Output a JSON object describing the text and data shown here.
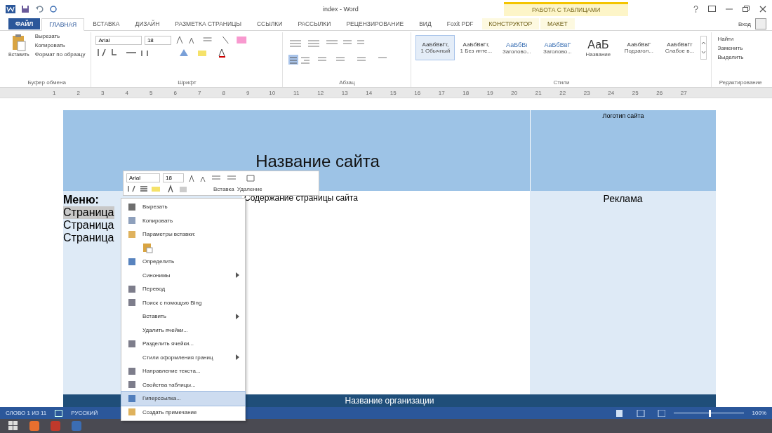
{
  "window": {
    "title": "index - Word",
    "context_tab_group": "РАБОТА С ТАБЛИЦАМИ",
    "sign_in": "Вход"
  },
  "tabs": [
    {
      "label": "ФАЙЛ",
      "kind": "file",
      "selected": false
    },
    {
      "label": "ГЛАВНАЯ",
      "kind": "tab",
      "selected": true
    },
    {
      "label": "ВСТАВКА",
      "kind": "tab",
      "selected": false
    },
    {
      "label": "ДИЗАЙН",
      "kind": "tab",
      "selected": false
    },
    {
      "label": "РАЗМЕТКА СТРАНИЦЫ",
      "kind": "tab",
      "selected": false
    },
    {
      "label": "ССЫЛКИ",
      "kind": "tab",
      "selected": false
    },
    {
      "label": "РАССЫЛКИ",
      "kind": "tab",
      "selected": false
    },
    {
      "label": "РЕЦЕНЗИРОВАНИЕ",
      "kind": "tab",
      "selected": false
    },
    {
      "label": "ВИД",
      "kind": "tab",
      "selected": false
    },
    {
      "label": "Foxit PDF",
      "kind": "tab",
      "selected": false
    },
    {
      "label": "КОНСТРУКТОР",
      "kind": "context",
      "selected": false
    },
    {
      "label": "МАКЕТ",
      "kind": "context",
      "selected": false
    }
  ],
  "ribbon": {
    "clipboard": {
      "paste": "Вставить",
      "items": [
        "Вырезать",
        "Копировать",
        "Формат по образцу"
      ],
      "group": "Буфер обмена"
    },
    "font": {
      "name": "Arial",
      "size": "18",
      "group": "Шрифт"
    },
    "paragraph": {
      "group": "Абзац"
    },
    "styles": {
      "items": [
        {
          "sample": "АаБбВвГг,",
          "name": "1 Обычный",
          "selected": true
        },
        {
          "sample": "АаБбВвГг,",
          "name": "1 Без инте...",
          "selected": false
        },
        {
          "sample": "АаБбВı",
          "name": "Заголово...",
          "selected": false
        },
        {
          "sample": "АаБбВвГ",
          "name": "Заголово...",
          "selected": false
        },
        {
          "sample": "АаБ",
          "name": "Название",
          "selected": false
        },
        {
          "sample": "АаБбВвГ",
          "name": "Подзагол...",
          "selected": false
        },
        {
          "sample": "АаБбВвГг",
          "name": "Слабое в...",
          "selected": false
        }
      ],
      "group": "Стили"
    },
    "editing": {
      "items": [
        "Найти",
        "Заменить",
        "Выделить"
      ],
      "group": "Редактирование"
    }
  },
  "ruler": [
    "1",
    "2",
    "3",
    "4",
    "5",
    "6",
    "7",
    "8",
    "9",
    "10",
    "11",
    "12",
    "13",
    "14",
    "15",
    "16",
    "17",
    "18",
    "19",
    "20",
    "21",
    "22",
    "23",
    "24",
    "25",
    "26",
    "27"
  ],
  "document": {
    "site_title": "Название сайта",
    "logo": "Логотип сайта",
    "menu_title": "Меню:",
    "menu_items": [
      "Страница",
      "Страница",
      "Страница"
    ],
    "content": "Содержание страницы сайта",
    "ads": "Реклама",
    "footer": "Название организации"
  },
  "mini_toolbar": {
    "font": "Arial",
    "size": "18",
    "insert": "Вставка",
    "delete": "Удаление"
  },
  "context_menu": [
    {
      "label": "Вырезать",
      "kind": "item",
      "submenu": false,
      "selected": false
    },
    {
      "label": "Копировать",
      "kind": "item",
      "submenu": false,
      "selected": false
    },
    {
      "label": "Параметры вставки:",
      "kind": "item",
      "submenu": false,
      "selected": false
    },
    {
      "kind": "paste-options"
    },
    {
      "label": "Определить",
      "kind": "item",
      "submenu": false,
      "selected": false
    },
    {
      "label": "Синонимы",
      "kind": "item",
      "submenu": true,
      "selected": false
    },
    {
      "label": "Перевод",
      "kind": "item",
      "submenu": false,
      "selected": false
    },
    {
      "label": "Поиск с помощью Bing",
      "kind": "item",
      "submenu": false,
      "selected": false
    },
    {
      "label": "Вставить",
      "kind": "item",
      "submenu": true,
      "selected": false
    },
    {
      "label": "Удалить ячейки...",
      "kind": "item",
      "submenu": false,
      "selected": false
    },
    {
      "label": "Разделить ячейки...",
      "kind": "item",
      "submenu": false,
      "selected": false
    },
    {
      "label": "Стили оформления границ",
      "kind": "item",
      "submenu": true,
      "selected": false
    },
    {
      "label": "Направление текста...",
      "kind": "item",
      "submenu": false,
      "selected": false
    },
    {
      "label": "Свойства таблицы...",
      "kind": "item",
      "submenu": false,
      "selected": false
    },
    {
      "label": "Гиперссылка...",
      "kind": "item",
      "submenu": false,
      "selected": true
    },
    {
      "label": "Создать примечание",
      "kind": "item",
      "submenu": false,
      "selected": false
    }
  ],
  "status_bar": {
    "words": "СЛОВО 1 ИЗ 11",
    "language": "РУССКИЙ",
    "zoom": "100%",
    "level": 0.5
  }
}
